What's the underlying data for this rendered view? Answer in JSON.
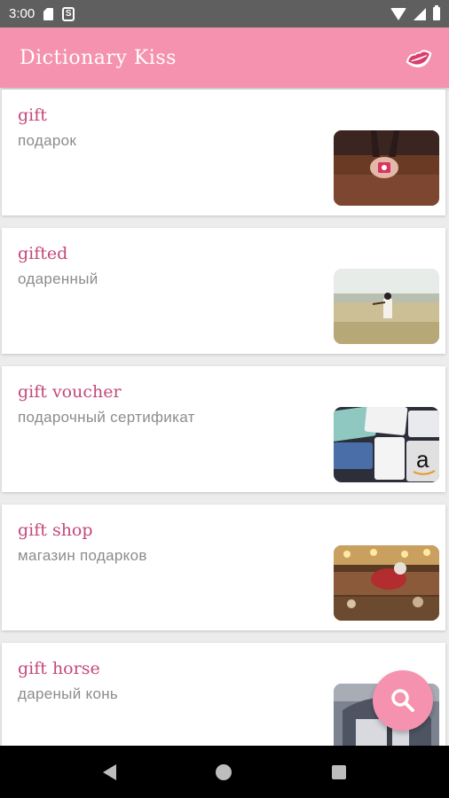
{
  "status_bar": {
    "time": "3:00"
  },
  "app_bar": {
    "title": "Dictionary Kiss",
    "logo_icon": "lips-icon"
  },
  "entries": [
    {
      "word": "gift",
      "translation": "подарок",
      "image": "gift-box-in-hands-photo"
    },
    {
      "word": "gifted",
      "translation": "одаренный",
      "image": "violinist-in-field-photo"
    },
    {
      "word": "gift voucher",
      "translation": "подарочный сертификат",
      "image": "gift-cards-photo"
    },
    {
      "word": "gift shop",
      "translation": "магазин подарков",
      "image": "gift-shop-display-photo"
    },
    {
      "word": "gift horse",
      "translation": "дареный конь",
      "image": "horse-photo"
    }
  ],
  "fab": {
    "icon": "search-icon"
  },
  "colors": {
    "accent": "#f592b0",
    "word": "#c4487a",
    "translation": "#8c8c8c"
  }
}
